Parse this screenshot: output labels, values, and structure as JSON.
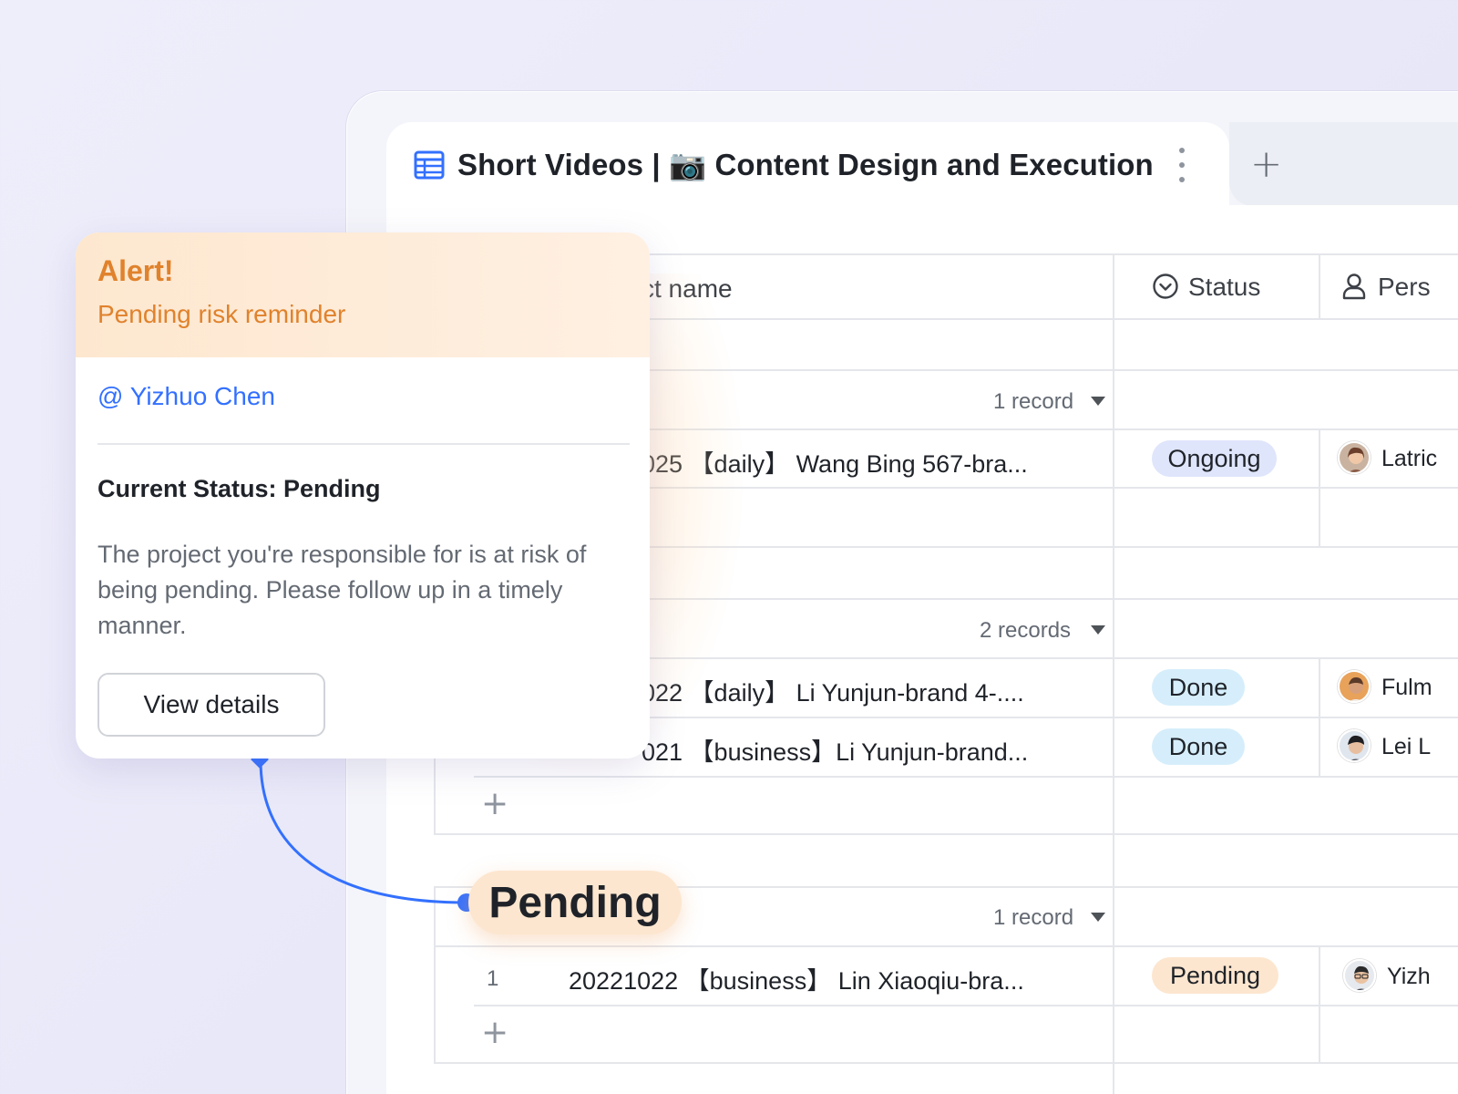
{
  "tab": {
    "title": "Short Videos | 📷 Content Design and Execution",
    "add_label": "+"
  },
  "table": {
    "headers": {
      "name": "ct name",
      "status": "Status",
      "person": "Pers"
    },
    "groups": [
      {
        "count_label": "1 record",
        "rows": [
          {
            "index": "",
            "name": "025 【daily】 Wang Bing 567-bra...",
            "status": "Ongoing",
            "person": "Latric"
          }
        ]
      },
      {
        "count_label": "2 records",
        "rows": [
          {
            "index": "",
            "name": "022 【daily】 Li Yunjun-brand 4-....",
            "status": "Done",
            "person": "Fulm"
          },
          {
            "index": "",
            "name": "021 【business】Li Yunjun-brand...",
            "status": "Done",
            "person": "Lei L"
          }
        ]
      },
      {
        "label": "Pending",
        "count_label": "1 record",
        "rows": [
          {
            "index": "1",
            "name": "20221022 【business】 Lin Xiaoqiu-bra...",
            "status": "Pending",
            "person": "Yizh"
          }
        ]
      }
    ],
    "add_row_label": "+"
  },
  "status_colors": {
    "Ongoing": "#dfe5fb",
    "Done": "#d6eefb",
    "Pending": "#fde6cf"
  },
  "alert": {
    "title": "Alert!",
    "subtitle": "Pending risk reminder",
    "mention": "@ Yizhuo Chen",
    "status_line": "Current Status: Pending",
    "body": "The project you're responsible for is at risk of being pending. Please follow up in a timely manner.",
    "button_label": "View details",
    "accent_color": "#e0822c"
  }
}
